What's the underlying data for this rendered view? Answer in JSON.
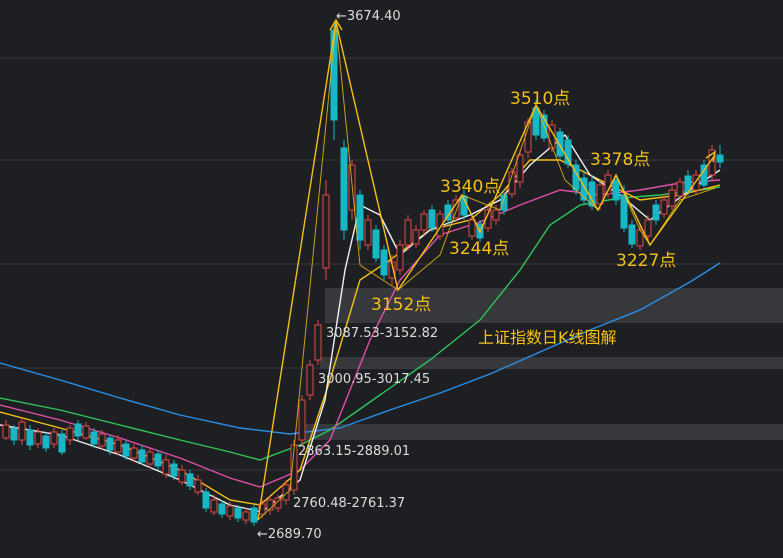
{
  "chart_data": {
    "type": "candlestick",
    "title": "上证指数日K线图解",
    "colors": {
      "background": "#1e1f22",
      "grid": "#3a3b3f",
      "band": "#3c3d41",
      "up": "#e04848",
      "down": "#17b7c6",
      "annotation": "#f4c018",
      "ma_fast": "#f0f0f0",
      "ma_mid": "#f4c018",
      "ma_slow": "#e04fa8",
      "ma_green": "#2ec45a",
      "ma_long": "#2a8fe8"
    },
    "price_labels": [
      {
        "text": "←3674.40",
        "price": 3674.4
      },
      {
        "text": "3087.53-3152.82",
        "price": 3087
      },
      {
        "text": "3000.95-3017.45",
        "price": 3000
      },
      {
        "text": "2863.15-2889.01",
        "price": 2863
      },
      {
        "text": "2760.48-2761.37",
        "price": 2760
      },
      {
        "text": "←2689.70",
        "price": 2689.7
      }
    ],
    "point_labels": [
      {
        "text": "3510点",
        "price": 3510
      },
      {
        "text": "3378点",
        "price": 3378
      },
      {
        "text": "3340点",
        "price": 3340
      },
      {
        "text": "3244点",
        "price": 3244
      },
      {
        "text": "3227点",
        "price": 3227
      },
      {
        "text": "3152点",
        "price": 3152
      }
    ],
    "gap_bands": [
      {
        "from": 3087.53,
        "to": 3152.82
      },
      {
        "from": 3000.95,
        "to": 3017.45
      },
      {
        "from": 2863.15,
        "to": 2889.01
      }
    ],
    "yrange": [
      2670,
      3700
    ],
    "grid": true
  }
}
